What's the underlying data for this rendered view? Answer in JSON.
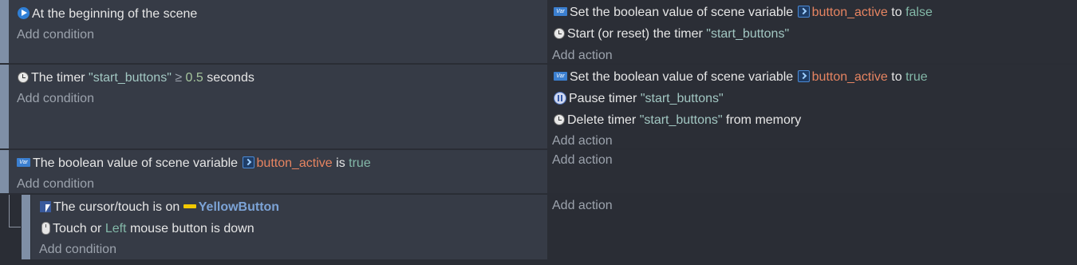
{
  "events": [
    {
      "conditions": [
        {
          "icon": "play-icon",
          "parts": [
            {
              "t": "At the beginning of the scene",
              "c": ""
            }
          ]
        }
      ],
      "actions": [
        {
          "icon": "variable-icon",
          "parts": [
            {
              "t": "Set the boolean value of scene variable ",
              "c": ""
            },
            {
              "icon": "scene-variable-icon"
            },
            {
              "t": "button_active",
              "c": "var"
            },
            {
              "t": " to ",
              "c": ""
            },
            {
              "t": "false",
              "c": "bool"
            }
          ]
        },
        {
          "icon": "timer-icon",
          "parts": [
            {
              "t": "Start (or reset) the timer ",
              "c": ""
            },
            {
              "t": "\"start_buttons\"",
              "c": "str"
            }
          ]
        }
      ],
      "add_condition": "Add condition",
      "add_action": "Add action"
    },
    {
      "conditions": [
        {
          "icon": "timer-icon",
          "parts": [
            {
              "t": "The timer ",
              "c": ""
            },
            {
              "t": "\"start_buttons\"",
              "c": "str"
            },
            {
              "t": "  ≥  ",
              "c": "add"
            },
            {
              "t": "0.5",
              "c": "num"
            },
            {
              "t": " seconds",
              "c": ""
            }
          ]
        }
      ],
      "actions": [
        {
          "icon": "variable-icon",
          "parts": [
            {
              "t": "Set the boolean value of scene variable ",
              "c": ""
            },
            {
              "icon": "scene-variable-icon"
            },
            {
              "t": "button_active",
              "c": "var"
            },
            {
              "t": " to ",
              "c": ""
            },
            {
              "t": "true",
              "c": "bool"
            }
          ]
        },
        {
          "icon": "pause-timer-icon",
          "parts": [
            {
              "t": "Pause timer ",
              "c": ""
            },
            {
              "t": "\"start_buttons\"",
              "c": "str"
            }
          ]
        },
        {
          "icon": "timer-icon",
          "parts": [
            {
              "t": "Delete timer ",
              "c": ""
            },
            {
              "t": "\"start_buttons\"",
              "c": "str"
            },
            {
              "t": " from memory",
              "c": ""
            }
          ]
        }
      ],
      "add_condition": "Add condition",
      "add_action": "Add action"
    },
    {
      "conditions": [
        {
          "icon": "variable-icon",
          "parts": [
            {
              "t": "The boolean value of scene variable ",
              "c": ""
            },
            {
              "icon": "scene-variable-icon"
            },
            {
              "t": "button_active",
              "c": "var"
            },
            {
              "t": " is ",
              "c": ""
            },
            {
              "t": "true",
              "c": "bool"
            }
          ]
        }
      ],
      "actions": [],
      "add_condition": "Add condition",
      "add_action": "Add action"
    }
  ],
  "sub_event": {
    "conditions": [
      {
        "icon": "cursor-icon",
        "parts": [
          {
            "t": "The cursor/touch is on ",
            "c": ""
          },
          {
            "icon": "yellow-button-icon"
          },
          {
            "t": "YellowButton",
            "c": "obj"
          }
        ]
      },
      {
        "icon": "mouse-icon",
        "parts": [
          {
            "t": "Touch or ",
            "c": ""
          },
          {
            "t": "Left",
            "c": "bool"
          },
          {
            "t": " mouse button is down",
            "c": ""
          }
        ]
      }
    ],
    "add_condition": "Add condition",
    "add_action": "Add action"
  }
}
